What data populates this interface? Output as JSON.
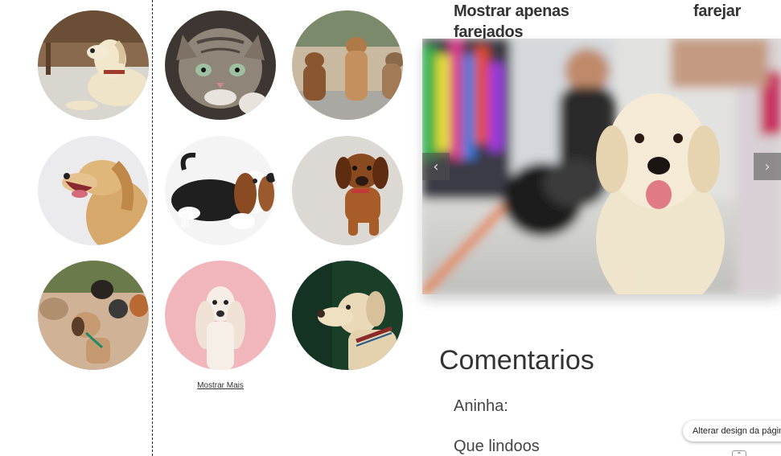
{
  "gallery": {
    "items": [
      {
        "name": "dog-photo-labrador-lying",
        "bg": "#9a7d62"
      },
      {
        "name": "cat-photo-tabby",
        "bg": "#5a504c"
      },
      {
        "name": "dog-photo-three-puppies",
        "bg": "#b8a890"
      },
      {
        "name": "dog-photo-golden-retriever-yawning",
        "bg": "#e9e9ec"
      },
      {
        "name": "dog-photo-basset-hound",
        "bg": "#f2f2f2"
      },
      {
        "name": "dog-photo-brown-puppy",
        "bg": "#d8d4d0"
      },
      {
        "name": "dog-photo-group-pack",
        "bg": "#c9a88a"
      },
      {
        "name": "dog-photo-afghan-hound-pink",
        "bg": "#efb6bb"
      },
      {
        "name": "dog-photo-labrador-forest",
        "bg": "#1d4a30"
      }
    ],
    "more_label": "Mostrar Mais"
  },
  "header": {
    "left_text": "Mostrar apenas farejados",
    "right_text": "farejar"
  },
  "slideshow": {
    "prev_symbol": "‹",
    "next_symbol": "›"
  },
  "comments": {
    "title": "Comentarios",
    "author": "Aninha:",
    "text": "Que lindoos"
  },
  "editor": {
    "design_button_label": "Alterar design da página"
  }
}
